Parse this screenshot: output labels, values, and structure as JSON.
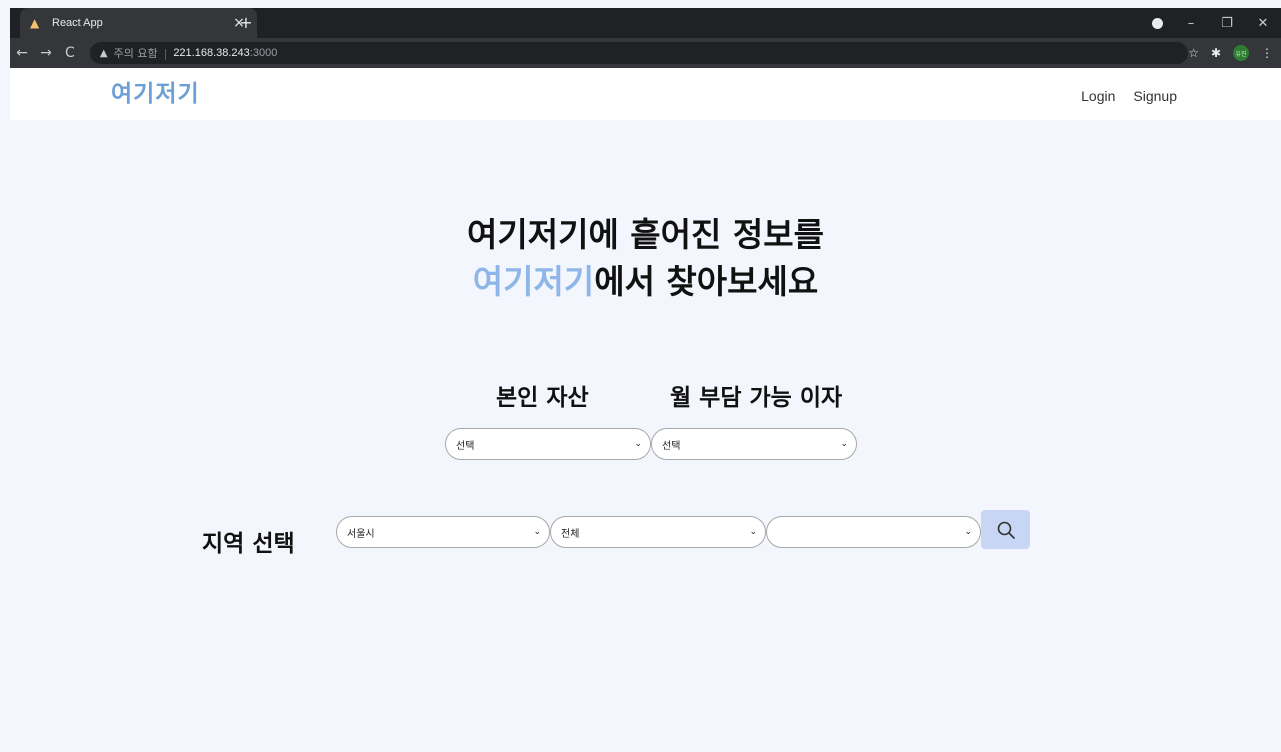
{
  "browser": {
    "tab_title": "React App",
    "tab_close": "×",
    "new_tab": "+",
    "nav_back": "←",
    "nav_forward": "→",
    "nav_reload": "C",
    "security_warning": "주의 요함",
    "url_separator": "|",
    "url_host": "221.168.38.243",
    "url_port": ":3000",
    "bookmark_star": "☆",
    "extensions": "✱",
    "profile_initials": "유진",
    "menu": "⋮",
    "win_minimize": "–",
    "win_maximize": "❐",
    "win_close": "✕"
  },
  "header": {
    "logo": "여기저기",
    "login": "Login",
    "signup": "Signup"
  },
  "hero": {
    "line1": "여기저기에 흩어진 정보를",
    "line2_brand": "여기저기",
    "line2_rest": "에서 찾아보세요"
  },
  "filters": {
    "asset_label": "본인 자산",
    "interest_label": "월 부담 가능 이자",
    "asset_select": "선택",
    "interest_select": "선택",
    "region_label": "지역 선택",
    "region_city": "서울시",
    "region_district": "전체",
    "region_dong": ""
  },
  "icons": {
    "favicon": "house-icon",
    "search": "search-icon",
    "chevron": "chevron-down-icon"
  }
}
